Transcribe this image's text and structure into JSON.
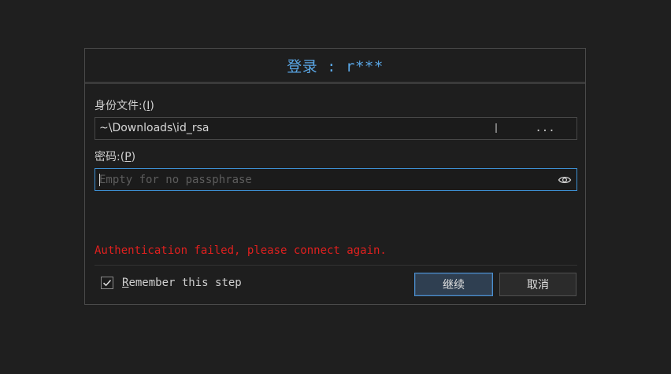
{
  "dialog": {
    "title": "登录 : r***"
  },
  "identity": {
    "label_prefix": "身份文件:(",
    "label_key": "I",
    "label_suffix": ")",
    "value": "~\\Downloads\\id_rsa",
    "browse_label": "..."
  },
  "password": {
    "label_prefix": "密码:(",
    "label_key": "P",
    "label_suffix": ")",
    "value": "",
    "placeholder": "Empty for no passphrase",
    "toggle_icon": "eye-icon"
  },
  "error": {
    "message": "Authentication failed, please connect again.",
    "color": "#e0201e"
  },
  "remember": {
    "label_key": "R",
    "label_rest": "emember this step",
    "checked": true
  },
  "buttons": {
    "continue_label": "继续",
    "cancel_label": "取消"
  },
  "colors": {
    "accent": "#5aa7e6",
    "focus_border": "#3d8fd1"
  }
}
